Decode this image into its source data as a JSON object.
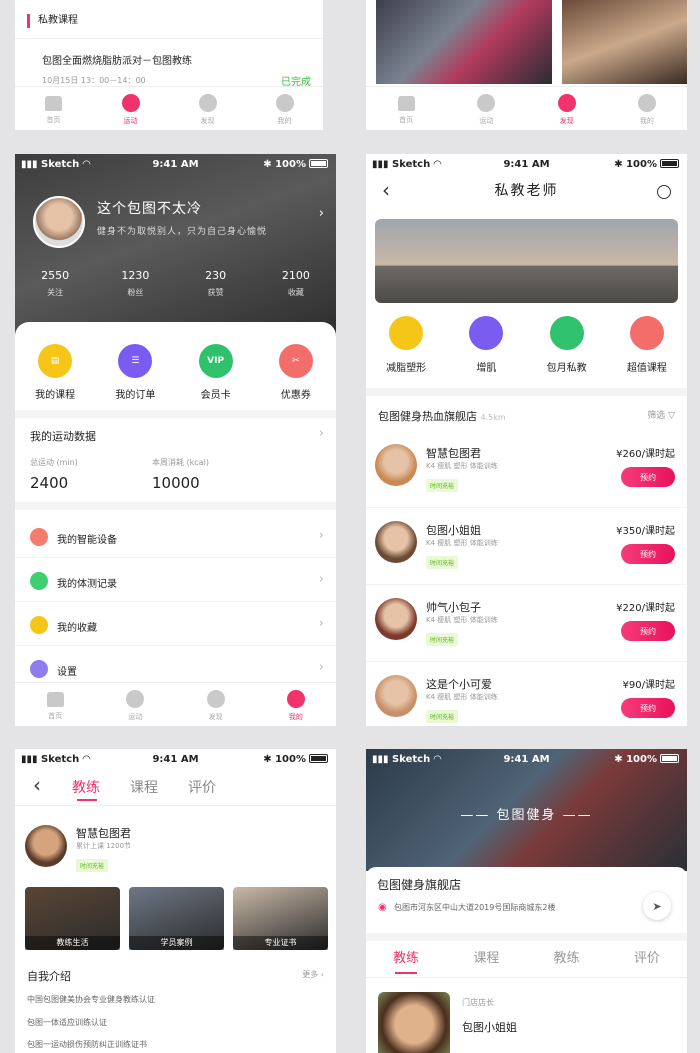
{
  "s1": {
    "section": "私教课程",
    "course": "包图全面燃烧脂肪派对－包图教练",
    "time": "10月15日 13：00－14：00",
    "status": "已完成",
    "tabs": [
      "首页",
      "运动",
      "发现",
      "我的"
    ]
  },
  "s2": {
    "tabs": [
      "首页",
      "运动",
      "发现",
      "我的"
    ]
  },
  "status": {
    "carrier": "Sketch",
    "time": "9:41 AM",
    "battery": "100%"
  },
  "profile": {
    "name": "这个包图不太冷",
    "motto": "健身不为取悦别人，只为自己身心愉悦",
    "stats": [
      {
        "v": "2550",
        "l": "关注"
      },
      {
        "v": "1230",
        "l": "粉丝"
      },
      {
        "v": "230",
        "l": "获赞"
      },
      {
        "v": "2100",
        "l": "收藏"
      }
    ],
    "quick": [
      {
        "l": "我的课程",
        "c": "#f5c518",
        "g": "▤"
      },
      {
        "l": "我的订单",
        "c": "#7a5cf0",
        "g": "☰"
      },
      {
        "l": "会员卡",
        "c": "#2fc16b",
        "g": "VIP"
      },
      {
        "l": "优惠券",
        "c": "#f36d6a",
        "g": "✂"
      }
    ],
    "data_title": "我的运动数据",
    "dist_label": "总运动 (min)",
    "dist": "2400",
    "cal_label": "本周消耗 (kcal)",
    "cal": "10000",
    "menu": [
      {
        "l": "我的智能设备",
        "c": "#f47b6d"
      },
      {
        "l": "我的体测记录",
        "c": "#3fcf6e"
      },
      {
        "l": "我的收藏",
        "c": "#f5c518"
      },
      {
        "l": "设置",
        "c": "#8f7cf0"
      }
    ],
    "tabs": [
      "首页",
      "运动",
      "发现",
      "我的"
    ]
  },
  "coaches": {
    "title": "私教老师",
    "cats": [
      {
        "l": "减脂塑形",
        "c": "#f5c518"
      },
      {
        "l": "增肌",
        "c": "#7a5cf0"
      },
      {
        "l": "包月私教",
        "c": "#2fc16b"
      },
      {
        "l": "超值课程",
        "c": "#f36d6a"
      }
    ],
    "store": "包图健身热血旗舰店",
    "dist": "4.5km",
    "filter": "筛选",
    "list": [
      {
        "name": "智慧包图君",
        "tags": "K4 瘦肌 塑形 体能训练",
        "badge": "时间充裕",
        "price": "¥260/课时起",
        "btn": "预约",
        "c": "#c98a55"
      },
      {
        "name": "包图小姐姐",
        "tags": "K4 瘦肌 塑形 体能训练",
        "badge": "时间充裕",
        "price": "¥350/课时起",
        "btn": "预约",
        "c": "#6b4a36"
      },
      {
        "name": "帅气小包子",
        "tags": "K4 瘦肌 塑形 体能训练",
        "badge": "时间充裕",
        "price": "¥220/课时起",
        "btn": "预约",
        "c": "#7c3a2a"
      },
      {
        "name": "这是个小可爱",
        "tags": "K4 瘦肌 塑形 体能训练",
        "badge": "时间充裕",
        "price": "¥90/课时起",
        "btn": "预约",
        "c": "#c8906a"
      }
    ]
  },
  "coach": {
    "tabs": [
      "教练",
      "课程",
      "评价"
    ],
    "name": "智慧包图君",
    "lessons": "累计上课 1200节",
    "badge": "时间充裕",
    "photos": [
      "教练生活",
      "学员案例",
      "专业证书"
    ],
    "intro_title": "自我介绍",
    "more": "更多",
    "intro": [
      "中国包图健美协会专业健身教练认证",
      "包图一体适应训练认证",
      "包图一运动损伤预防纠正训练证书"
    ]
  },
  "store": {
    "brand": "包图健身",
    "name": "包图健身旗舰店",
    "addr": "包图市河东区中山大道2019号国际商城东2楼",
    "tabs": [
      "教练",
      "课程",
      "教练",
      "评价"
    ],
    "role": "门店店长",
    "coach": "包图小姐姐"
  }
}
